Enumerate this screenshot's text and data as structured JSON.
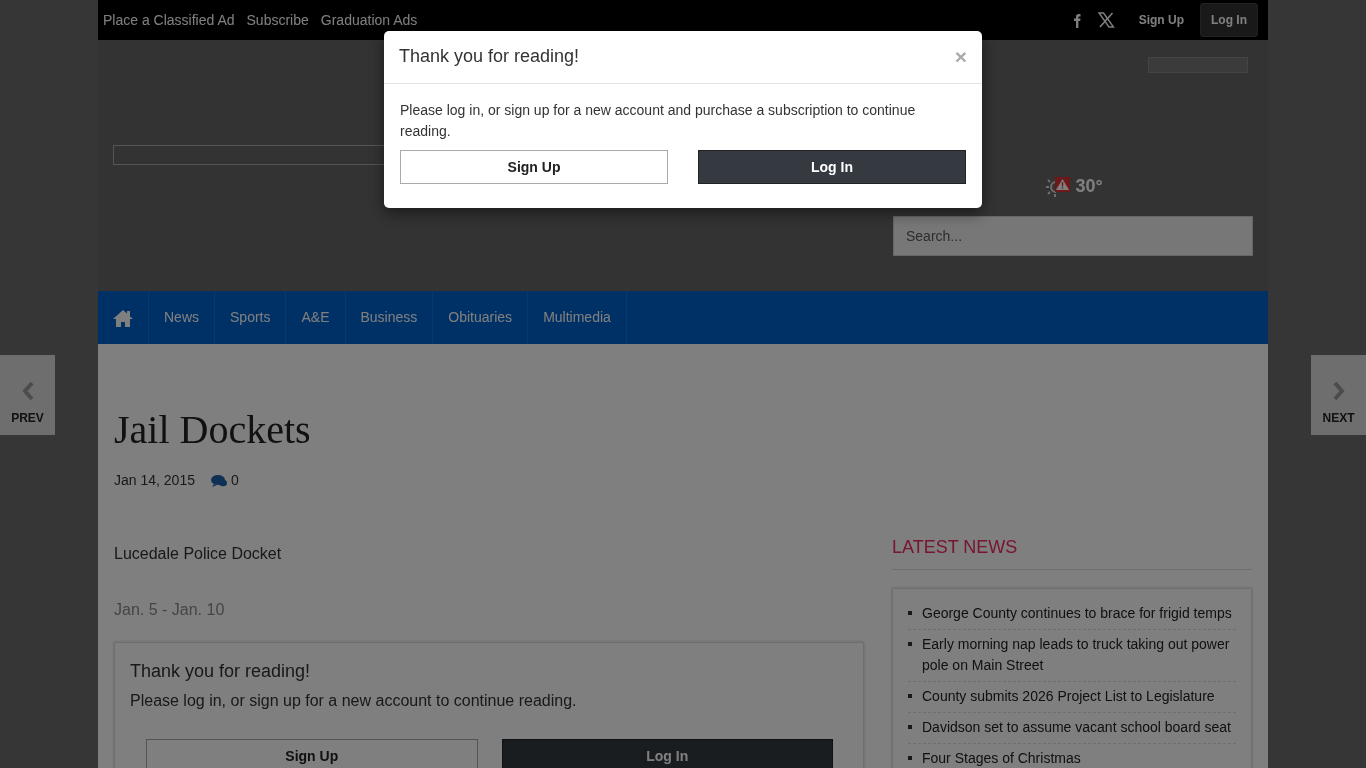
{
  "top_bar": {
    "links": [
      "Place a Classified Ad",
      "Subscribe",
      "Graduation Ads"
    ],
    "sign_up": "Sign Up",
    "log_in": "Log In"
  },
  "header": {
    "weather": {
      "temperature": "30°",
      "alert": true
    },
    "search": {
      "placeholder": "Search..."
    }
  },
  "nav": {
    "items": [
      {
        "label": "News",
        "selected": false
      },
      {
        "label": "Sports",
        "selected": false
      },
      {
        "label": "A&E",
        "selected": false
      },
      {
        "label": "Business",
        "selected": false
      },
      {
        "label": "Obituaries",
        "selected": false
      },
      {
        "label": "Multimedia",
        "selected": false
      }
    ]
  },
  "article": {
    "title": "Jail Dockets",
    "date": "Jan 14, 2015",
    "comments": "0",
    "paragraphs": [
      {
        "text": "Lucedale Police Docket",
        "kind": "normal"
      },
      {
        "text": "Jan. 5 - Jan. 10",
        "kind": "faded"
      }
    ],
    "paywall": {
      "title": "Thank you for reading!",
      "text": "Please log in, or sign up for a new account to continue reading.",
      "buttons": [
        {
          "label": "Sign Up",
          "kind": "outline"
        },
        {
          "label": "Log In",
          "kind": "dark"
        }
      ]
    }
  },
  "sidebar": {
    "heading": "LATEST NEWS",
    "items": [
      "George County continues to brace for frigid temps",
      "Early morning nap leads to truck taking out power pole on Main Street",
      "County submits 2026 Project List to Legislature",
      "Davidson set to assume vacant school board seat",
      "Four Stages of Christmas"
    ]
  },
  "pager": {
    "prev": "PREV",
    "next": "NEXT"
  },
  "modal": {
    "title": "Thank you for reading!",
    "close": "×",
    "text": "Please log in, or sign up for a new account and purchase a subscription to continue reading.",
    "buttons": [
      {
        "label": "Sign Up",
        "kind": "outline"
      },
      {
        "label": "Log In",
        "kind": "dark"
      }
    ]
  }
}
